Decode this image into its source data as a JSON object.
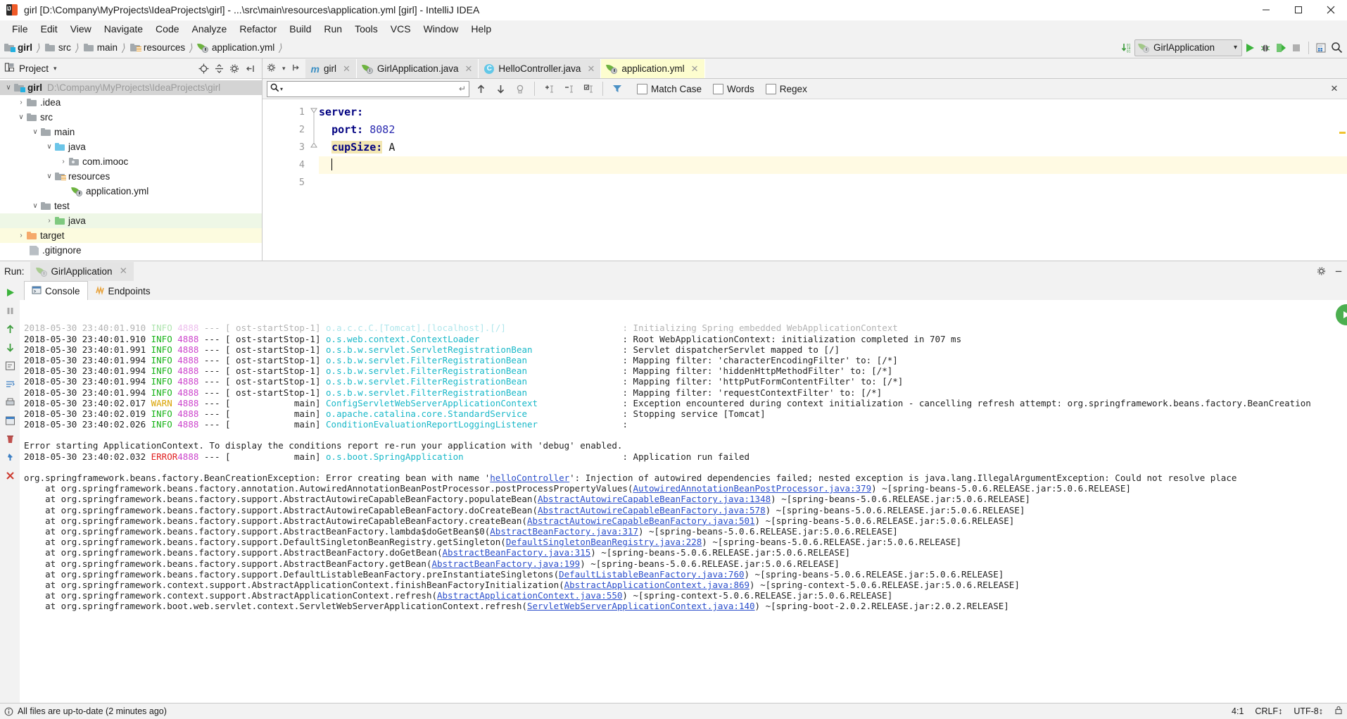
{
  "window": {
    "title": "girl [D:\\Company\\MyProjects\\IdeaProjects\\girl] - ...\\src\\main\\resources\\application.yml [girl] - IntelliJ IDEA",
    "minimize": "—",
    "maximize": "❐",
    "close": "✕"
  },
  "menu": [
    {
      "label": "File"
    },
    {
      "label": "Edit"
    },
    {
      "label": "View"
    },
    {
      "label": "Navigate"
    },
    {
      "label": "Code"
    },
    {
      "label": "Analyze"
    },
    {
      "label": "Refactor"
    },
    {
      "label": "Build"
    },
    {
      "label": "Run"
    },
    {
      "label": "Tools"
    },
    {
      "label": "VCS"
    },
    {
      "label": "Window"
    },
    {
      "label": "Help"
    }
  ],
  "navbar": {
    "crumbs": [
      {
        "label": "girl",
        "icon": "folder-module-icon"
      },
      {
        "label": "src",
        "icon": "folder-icon"
      },
      {
        "label": "main",
        "icon": "folder-icon"
      },
      {
        "label": "resources",
        "icon": "folder-resources-icon"
      },
      {
        "label": "application.yml",
        "icon": "spring-leaf-icon"
      }
    ],
    "separator": "›",
    "run_config": "GirlApplication",
    "run_config_caret": "⌄",
    "update_icon": "download-binary-icon",
    "buttons": [
      {
        "name": "run-button",
        "glyph": "▶"
      },
      {
        "name": "debug-button",
        "glyph": "bug"
      },
      {
        "name": "coverage-button",
        "glyph": "coverage"
      },
      {
        "name": "stop-button",
        "glyph": "■"
      },
      {
        "name": "database-button",
        "glyph": "db"
      },
      {
        "name": "search-everywhere-button",
        "glyph": "⚲"
      }
    ]
  },
  "sidebar": {
    "title": "Project",
    "caret": "▾",
    "tools": [
      {
        "name": "locate-icon",
        "glyph": "⊕"
      },
      {
        "name": "collapse-all-icon",
        "glyph": "≡"
      },
      {
        "name": "settings-icon",
        "glyph": "⚙"
      },
      {
        "name": "hide-icon",
        "glyph": "→|"
      }
    ],
    "tree": [
      {
        "label": "girl",
        "path": "D:\\Company\\MyProjects\\IdeaProjects\\girl",
        "depth": 0,
        "arrow": "∨",
        "icon": "folder-module-icon",
        "state": "selected",
        "bold": true
      },
      {
        "label": ".idea",
        "path": "",
        "depth": 1,
        "arrow": "›",
        "icon": "folder-icon",
        "state": "",
        "bold": false
      },
      {
        "label": "src",
        "path": "",
        "depth": 1,
        "arrow": "∨",
        "icon": "folder-icon",
        "state": "",
        "bold": false
      },
      {
        "label": "main",
        "path": "",
        "depth": 2,
        "arrow": "∨",
        "icon": "folder-icon",
        "state": "",
        "bold": false
      },
      {
        "label": "java",
        "path": "",
        "depth": 3,
        "arrow": "∨",
        "icon": "folder-source-icon",
        "state": "",
        "bold": false
      },
      {
        "label": "com.imooc",
        "path": "",
        "depth": 4,
        "arrow": "›",
        "icon": "folder-package-icon",
        "state": "",
        "bold": false
      },
      {
        "label": "resources",
        "path": "",
        "depth": 3,
        "arrow": "∨",
        "icon": "folder-resources-icon",
        "state": "",
        "bold": false
      },
      {
        "label": "application.yml",
        "path": "",
        "depth": 4,
        "arrow": "",
        "icon": "spring-leaf-icon",
        "state": "",
        "bold": false
      },
      {
        "label": "test",
        "path": "",
        "depth": 2,
        "arrow": "∨",
        "icon": "folder-icon",
        "state": "",
        "bold": false
      },
      {
        "label": "java",
        "path": "",
        "depth": 3,
        "arrow": "›",
        "icon": "folder-test-source-icon",
        "state": "green",
        "bold": false
      },
      {
        "label": "target",
        "path": "",
        "depth": 1,
        "arrow": "›",
        "icon": "folder-excluded-icon",
        "state": "yellow",
        "bold": false
      },
      {
        "label": ".gitignore",
        "path": "",
        "depth": 1,
        "arrow": "",
        "icon": "file-icon",
        "state": "",
        "bold": false
      }
    ]
  },
  "editor": {
    "tabs": [
      {
        "label": "girl",
        "icon": "maven-icon",
        "active": false,
        "close": "✕"
      },
      {
        "label": "GirlApplication.java",
        "icon": "spring-class-icon",
        "active": false,
        "close": "✕"
      },
      {
        "label": "HelloController.java",
        "icon": "java-class-icon",
        "active": false,
        "close": "✕"
      },
      {
        "label": "application.yml",
        "icon": "spring-leaf-icon",
        "active": true,
        "close": "✕"
      }
    ],
    "tab_close_all": "✕",
    "find": {
      "value": "",
      "placeholder": "",
      "search_icon": "search-icon",
      "dropdown_caret": "▾",
      "return_glyph": "↵",
      "buttons": [
        {
          "name": "find-previous-icon",
          "glyph": "↑"
        },
        {
          "name": "find-next-icon",
          "glyph": "↓"
        },
        {
          "name": "select-all-occurrences-icon",
          "glyph": "⬚"
        },
        {
          "name": "add-selection-icon",
          "glyph": "+"
        },
        {
          "name": "remove-selection-icon",
          "glyph": "-"
        },
        {
          "name": "select-all-icon",
          "glyph": "☑"
        },
        {
          "name": "filter-icon",
          "glyph": "▼"
        }
      ],
      "options": [
        {
          "label": "Match Case",
          "checked": false
        },
        {
          "label": "Words",
          "checked": false
        },
        {
          "label": "Regex",
          "checked": false
        }
      ],
      "close": "✕"
    },
    "gutter": [
      "1",
      "2",
      "3",
      "4",
      "5"
    ],
    "lines": [
      {
        "n": 1,
        "indent": 0,
        "key": "server:",
        "value": "",
        "current": false,
        "highlight_key": false
      },
      {
        "n": 2,
        "indent": 2,
        "key": "port:",
        "value": " 8082",
        "current": false,
        "highlight_key": false,
        "value_numeric": true
      },
      {
        "n": 3,
        "indent": 2,
        "key": "cupSize:",
        "value": " A",
        "current": false,
        "highlight_key": true
      },
      {
        "n": 4,
        "indent": 2,
        "key": "",
        "value": "",
        "current": true,
        "highlight_key": false
      },
      {
        "n": 5,
        "indent": 0,
        "key": "",
        "value": "",
        "current": false,
        "highlight_key": false
      }
    ]
  },
  "run": {
    "label": "Run:",
    "config_name": "GirlApplication",
    "config_close": "✕",
    "settings_icon": "⚙",
    "hide_icon": "—",
    "subtabs": [
      {
        "label": "Console",
        "icon": "console-icon",
        "active": true
      },
      {
        "label": "Endpoints",
        "icon": "endpoints-icon",
        "active": false
      }
    ],
    "rail": [
      {
        "name": "rerun-icon",
        "glyph": "▶"
      },
      {
        "name": "pause-icon",
        "glyph": "⏸"
      },
      {
        "name": "scroll-up-icon",
        "glyph": "↑"
      },
      {
        "name": "scroll-down-icon",
        "glyph": "↓"
      },
      {
        "name": "soft-wrap-icon",
        "glyph": "↵"
      },
      {
        "name": "print-icon",
        "glyph": "⎙"
      },
      {
        "name": "clear-all-icon",
        "glyph": "🗑"
      },
      {
        "name": "pin-icon",
        "glyph": "📌"
      },
      {
        "name": "close-icon",
        "glyph": "✕"
      }
    ],
    "console": [
      {
        "type": "log",
        "time": "2018-05-30 23:40:01.910",
        "level": "INFO",
        "pid": "4888",
        "thread": "ost-startStop-1",
        "logger": "o.a.c.c.C.[Tomcat].[localhost].[/]",
        "msg": ": Initializing Spring embedded WebApplicationContext",
        "clipped": true
      },
      {
        "type": "log",
        "time": "2018-05-30 23:40:01.910",
        "level": "INFO",
        "pid": "4888",
        "thread": "ost-startStop-1",
        "logger": "o.s.web.context.ContextLoader",
        "msg": ": Root WebApplicationContext: initialization completed in 707 ms"
      },
      {
        "type": "log",
        "time": "2018-05-30 23:40:01.991",
        "level": "INFO",
        "pid": "4888",
        "thread": "ost-startStop-1",
        "logger": "o.s.b.w.servlet.ServletRegistrationBean",
        "msg": ": Servlet dispatcherServlet mapped to [/]"
      },
      {
        "type": "log",
        "time": "2018-05-30 23:40:01.994",
        "level": "INFO",
        "pid": "4888",
        "thread": "ost-startStop-1",
        "logger": "o.s.b.w.servlet.FilterRegistrationBean",
        "msg": ": Mapping filter: 'characterEncodingFilter' to: [/*]"
      },
      {
        "type": "log",
        "time": "2018-05-30 23:40:01.994",
        "level": "INFO",
        "pid": "4888",
        "thread": "ost-startStop-1",
        "logger": "o.s.b.w.servlet.FilterRegistrationBean",
        "msg": ": Mapping filter: 'hiddenHttpMethodFilter' to: [/*]"
      },
      {
        "type": "log",
        "time": "2018-05-30 23:40:01.994",
        "level": "INFO",
        "pid": "4888",
        "thread": "ost-startStop-1",
        "logger": "o.s.b.w.servlet.FilterRegistrationBean",
        "msg": ": Mapping filter: 'httpPutFormContentFilter' to: [/*]"
      },
      {
        "type": "log",
        "time": "2018-05-30 23:40:01.994",
        "level": "INFO",
        "pid": "4888",
        "thread": "ost-startStop-1",
        "logger": "o.s.b.w.servlet.FilterRegistrationBean",
        "msg": ": Mapping filter: 'requestContextFilter' to: [/*]"
      },
      {
        "type": "log",
        "time": "2018-05-30 23:40:02.017",
        "level": "WARN",
        "pid": "4888",
        "thread": "main",
        "logger": "ConfigServletWebServerApplicationContext",
        "msg": ": Exception encountered during context initialization - cancelling refresh attempt: org.springframework.beans.factory.BeanCreation"
      },
      {
        "type": "log",
        "time": "2018-05-30 23:40:02.019",
        "level": "INFO",
        "pid": "4888",
        "thread": "main",
        "logger": "o.apache.catalina.core.StandardService",
        "msg": ": Stopping service [Tomcat]"
      },
      {
        "type": "log",
        "time": "2018-05-30 23:40:02.026",
        "level": "INFO",
        "pid": "4888",
        "thread": "main",
        "logger": "ConditionEvaluationReportLoggingListener",
        "msg": ":"
      },
      {
        "type": "blank"
      },
      {
        "type": "plain",
        "text": "Error starting ApplicationContext. To display the conditions report re-run your application with 'debug' enabled."
      },
      {
        "type": "log",
        "time": "2018-05-30 23:40:02.032",
        "level": "ERROR",
        "pid": "4888",
        "thread": "main",
        "logger": "o.s.boot.SpringApplication",
        "msg": ": Application run failed"
      },
      {
        "type": "blank"
      },
      {
        "type": "exception",
        "pre": "org.springframework.beans.factory.BeanCreationException: Error creating bean with name '",
        "link": "helloController",
        "post": "': Injection of autowired dependencies failed; nested exception is java.lang.IllegalArgumentException: Could not resolve place"
      },
      {
        "type": "stack",
        "pre": "    at org.springframework.beans.factory.annotation.AutowiredAnnotationBeanPostProcessor.postProcessPropertyValues(",
        "link": "AutowiredAnnotationBeanPostProcessor.java:379",
        "post": ") ~[spring-beans-5.0.6.RELEASE.jar:5.0.6.RELEASE]"
      },
      {
        "type": "stack",
        "pre": "    at org.springframework.beans.factory.support.AbstractAutowireCapableBeanFactory.populateBean(",
        "link": "AbstractAutowireCapableBeanFactory.java:1348",
        "post": ") ~[spring-beans-5.0.6.RELEASE.jar:5.0.6.RELEASE]"
      },
      {
        "type": "stack",
        "pre": "    at org.springframework.beans.factory.support.AbstractAutowireCapableBeanFactory.doCreateBean(",
        "link": "AbstractAutowireCapableBeanFactory.java:578",
        "post": ") ~[spring-beans-5.0.6.RELEASE.jar:5.0.6.RELEASE]"
      },
      {
        "type": "stack",
        "pre": "    at org.springframework.beans.factory.support.AbstractAutowireCapableBeanFactory.createBean(",
        "link": "AbstractAutowireCapableBeanFactory.java:501",
        "post": ") ~[spring-beans-5.0.6.RELEASE.jar:5.0.6.RELEASE]"
      },
      {
        "type": "stack",
        "pre": "    at org.springframework.beans.factory.support.AbstractBeanFactory.lambda$doGetBean$0(",
        "link": "AbstractBeanFactory.java:317",
        "post": ") ~[spring-beans-5.0.6.RELEASE.jar:5.0.6.RELEASE]"
      },
      {
        "type": "stack",
        "pre": "    at org.springframework.beans.factory.support.DefaultSingletonBeanRegistry.getSingleton(",
        "link": "DefaultSingletonBeanRegistry.java:228",
        "post": ") ~[spring-beans-5.0.6.RELEASE.jar:5.0.6.RELEASE]"
      },
      {
        "type": "stack",
        "pre": "    at org.springframework.beans.factory.support.AbstractBeanFactory.doGetBean(",
        "link": "AbstractBeanFactory.java:315",
        "post": ") ~[spring-beans-5.0.6.RELEASE.jar:5.0.6.RELEASE]"
      },
      {
        "type": "stack",
        "pre": "    at org.springframework.beans.factory.support.AbstractBeanFactory.getBean(",
        "link": "AbstractBeanFactory.java:199",
        "post": ") ~[spring-beans-5.0.6.RELEASE.jar:5.0.6.RELEASE]"
      },
      {
        "type": "stack",
        "pre": "    at org.springframework.beans.factory.support.DefaultListableBeanFactory.preInstantiateSingletons(",
        "link": "DefaultListableBeanFactory.java:760",
        "post": ") ~[spring-beans-5.0.6.RELEASE.jar:5.0.6.RELEASE]"
      },
      {
        "type": "stack",
        "pre": "    at org.springframework.context.support.AbstractApplicationContext.finishBeanFactoryInitialization(",
        "link": "AbstractApplicationContext.java:869",
        "post": ") ~[spring-context-5.0.6.RELEASE.jar:5.0.6.RELEASE]"
      },
      {
        "type": "stack",
        "pre": "    at org.springframework.context.support.AbstractApplicationContext.refresh(",
        "link": "AbstractApplicationContext.java:550",
        "post": ") ~[spring-context-5.0.6.RELEASE.jar:5.0.6.RELEASE]"
      },
      {
        "type": "stack",
        "pre": "    at org.springframework.boot.web.servlet.context.ServletWebServerApplicationContext.refresh(",
        "link": "ServletWebServerApplicationContext.java:140",
        "post": ") ~[spring-boot-2.0.2.RELEASE.jar:2.0.2.RELEASE]"
      }
    ]
  },
  "statusbar": {
    "message": "All files are up-to-date (2 minutes ago)",
    "caret_position": "4:1",
    "line_separator": "CRLF↕",
    "encoding": "UTF-8↕",
    "info_icon": "info-icon"
  }
}
